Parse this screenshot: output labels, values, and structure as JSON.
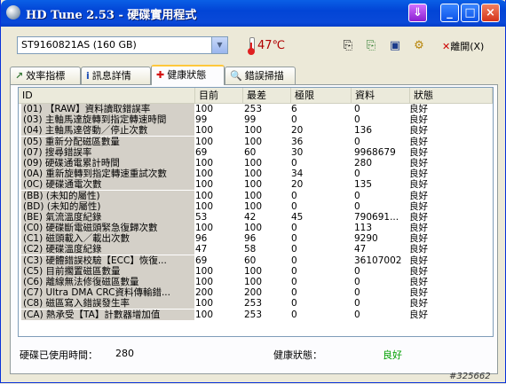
{
  "window": {
    "title": "HD Tune 2.53 - 硬碟實用程式"
  },
  "toolbar": {
    "drive": "ST9160821AS (160 GB)",
    "temperature": "47℃",
    "exit_label": "離開(X)"
  },
  "tabs": [
    {
      "label": "效率指標"
    },
    {
      "label": "訊息詳情"
    },
    {
      "label": "健康狀態"
    },
    {
      "label": "錯誤掃描"
    }
  ],
  "columns": [
    "ID",
    "目前",
    "最差",
    "極限",
    "資料",
    "狀態"
  ],
  "rows": [
    [
      "(01) 【RAW】資料讀取錯誤率",
      "100",
      "253",
      "6",
      "0",
      "良好"
    ],
    [
      "(03) 主軸馬達旋轉到指定轉速時間",
      "99",
      "99",
      "0",
      "0",
      "良好"
    ],
    [
      "(04) 主軸馬達啓動／停止次數",
      "100",
      "100",
      "20",
      "136",
      "良好"
    ],
    [
      "(05) 重新分配磁區數量",
      "100",
      "100",
      "36",
      "0",
      "良好"
    ],
    [
      "(07) 搜尋錯誤率",
      "69",
      "60",
      "30",
      "9968679",
      "良好"
    ],
    [
      "(09) 硬碟通電累計時間",
      "100",
      "100",
      "0",
      "280",
      "良好"
    ],
    [
      "(0A) 重新旋轉到指定轉速重試次數",
      "100",
      "100",
      "34",
      "0",
      "良好"
    ],
    [
      "(0C) 硬碟通電次數",
      "100",
      "100",
      "20",
      "135",
      "良好"
    ],
    [
      "(BB) (未知的屬性)",
      "100",
      "100",
      "0",
      "0",
      "良好"
    ],
    [
      "(BD) (未知的屬性)",
      "100",
      "100",
      "0",
      "0",
      "良好"
    ],
    [
      "(BE) 氣流溫度紀錄",
      "53",
      "42",
      "45",
      "790691...",
      "良好"
    ],
    [
      "(C0) 硬碟斷電磁頭緊急復歸次數",
      "100",
      "100",
      "0",
      "113",
      "良好"
    ],
    [
      "(C1) 磁頭載入／載出次數",
      "96",
      "96",
      "0",
      "9290",
      "良好"
    ],
    [
      "(C2) 硬碟溫度紀錄",
      "47",
      "58",
      "0",
      "47",
      "良好"
    ],
    [
      "(C3) 硬體錯誤校驗【ECC】恢復...",
      "69",
      "60",
      "0",
      "36107002",
      "良好"
    ],
    [
      "(C5) 目前擱置磁區數量",
      "100",
      "100",
      "0",
      "0",
      "良好"
    ],
    [
      "(C6) 離線無法修復磁區數量",
      "100",
      "100",
      "0",
      "0",
      "良好"
    ],
    [
      "(C7) Ultra DMA CRC資料傳輸錯...",
      "200",
      "200",
      "0",
      "0",
      "良好"
    ],
    [
      "(C8) 磁區寫入錯誤發生率",
      "100",
      "253",
      "0",
      "0",
      "良好"
    ],
    [
      "(CA) 熱承受【TA】計數器增加值",
      "100",
      "253",
      "0",
      "0",
      "良好"
    ]
  ],
  "footer": {
    "power_on_label": "硬碟已使用時間：",
    "power_on_value": "280",
    "health_label": "健康狀態：",
    "health_value": "良好"
  },
  "watermark": "#325662",
  "colors": {
    "health_ok": "#00a000",
    "temperature": "#b00000",
    "title_bar": "#0a5fe6"
  }
}
